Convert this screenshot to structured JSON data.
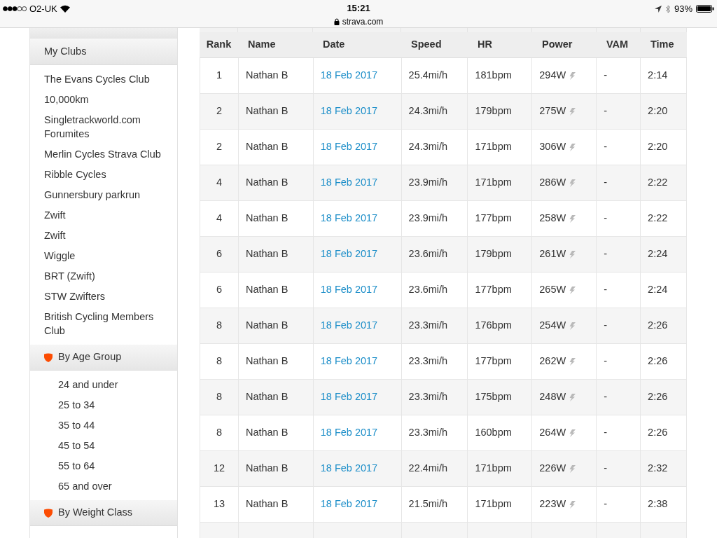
{
  "status_bar": {
    "carrier": "O2-UK",
    "time": "15:21",
    "url": "strava.com",
    "battery": "93%"
  },
  "sidebar": {
    "sections": [
      {
        "title": "My Clubs",
        "kind": "plain",
        "items": [
          "The Evans Cycles Club",
          "10,000km",
          "Singletrackworld.com Forumites",
          "Merlin Cycles Strava Club",
          "Ribble Cycles",
          "Gunnersbury parkrun",
          "Zwift",
          "Zwift",
          "Wiggle",
          "BRT (Zwift)",
          "STW Zwifters",
          "British Cycling Members Club"
        ]
      },
      {
        "title": "By Age Group",
        "kind": "category",
        "items": [
          "24 and under",
          "25 to 34",
          "35 to 44",
          "45 to 54",
          "55 to 64",
          "65 and over"
        ]
      },
      {
        "title": "By Weight Class",
        "kind": "category"
      }
    ]
  },
  "table": {
    "columns": [
      "Rank",
      "Name",
      "Date",
      "Speed",
      "HR",
      "Power",
      "VAM",
      "Time"
    ],
    "rows": [
      [
        "1",
        "Nathan B",
        "18 Feb 2017",
        "25.4mi/h",
        "181bpm",
        "294W",
        "-",
        "2:14"
      ],
      [
        "2",
        "Nathan B",
        "18 Feb 2017",
        "24.3mi/h",
        "179bpm",
        "275W",
        "-",
        "2:20"
      ],
      [
        "2",
        "Nathan B",
        "18 Feb 2017",
        "24.3mi/h",
        "171bpm",
        "306W",
        "-",
        "2:20"
      ],
      [
        "4",
        "Nathan B",
        "18 Feb 2017",
        "23.9mi/h",
        "171bpm",
        "286W",
        "-",
        "2:22"
      ],
      [
        "4",
        "Nathan B",
        "18 Feb 2017",
        "23.9mi/h",
        "177bpm",
        "258W",
        "-",
        "2:22"
      ],
      [
        "6",
        "Nathan B",
        "18 Feb 2017",
        "23.6mi/h",
        "179bpm",
        "261W",
        "-",
        "2:24"
      ],
      [
        "6",
        "Nathan B",
        "18 Feb 2017",
        "23.6mi/h",
        "177bpm",
        "265W",
        "-",
        "2:24"
      ],
      [
        "8",
        "Nathan B",
        "18 Feb 2017",
        "23.3mi/h",
        "176bpm",
        "254W",
        "-",
        "2:26"
      ],
      [
        "8",
        "Nathan B",
        "18 Feb 2017",
        "23.3mi/h",
        "177bpm",
        "262W",
        "-",
        "2:26"
      ],
      [
        "8",
        "Nathan B",
        "18 Feb 2017",
        "23.3mi/h",
        "175bpm",
        "248W",
        "-",
        "2:26"
      ],
      [
        "8",
        "Nathan B",
        "18 Feb 2017",
        "23.3mi/h",
        "160bpm",
        "264W",
        "-",
        "2:26"
      ],
      [
        "12",
        "Nathan B",
        "18 Feb 2017",
        "22.4mi/h",
        "171bpm",
        "226W",
        "-",
        "2:32"
      ],
      [
        "13",
        "Nathan B",
        "18 Feb 2017",
        "21.5mi/h",
        "171bpm",
        "223W",
        "-",
        "2:38"
      ]
    ]
  }
}
